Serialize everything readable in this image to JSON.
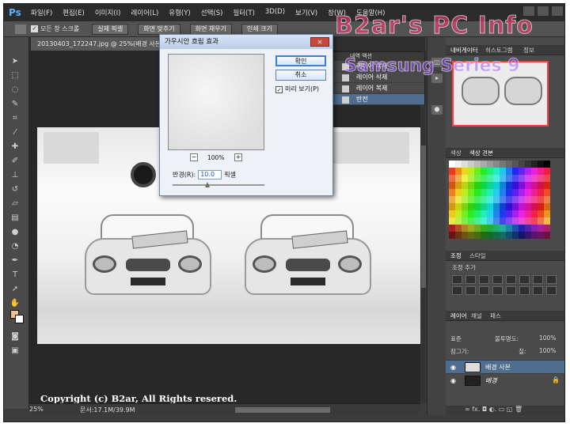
{
  "app": {
    "logo": "Ps"
  },
  "menu": [
    "파일(F)",
    "편집(E)",
    "이미지(I)",
    "레이어(L)",
    "유형(Y)",
    "선택(S)",
    "필터(T)",
    "3D(D)",
    "보기(V)",
    "창(W)",
    "도움말(H)"
  ],
  "options_bar": {
    "checkbox_label": "모든 창 스크롤",
    "buttons": [
      "실제 픽셀",
      "화면 맞추기",
      "화면 채우기",
      "인쇄 크기"
    ]
  },
  "document": {
    "tab_title": "20130403_172247.jpg @ 25%(배경 사본, RGB/8)",
    "copyright": "Copyright (c) B2ar, All Rights resered.",
    "zoom": "25%",
    "doc_size": "문서:17.1M/39.9M"
  },
  "dialog": {
    "title": "가우시안 흐림 효과",
    "ok": "확인",
    "cancel": "취소",
    "preview_label": "미리 보기(P)",
    "preview_checked": "✓",
    "zoom_out": "−",
    "zoom_in": "+",
    "zoom_pct": "100%",
    "radius_label": "반경(R):",
    "radius_value": "10.0",
    "radius_unit": "픽셀",
    "slider_level": 0.38
  },
  "history": {
    "header": "내역    액션",
    "items": [
      "레이어 복제",
      "레이어 삭제",
      "레이어 복제",
      "반전"
    ],
    "selected": 3
  },
  "panels": {
    "navigator_tabs": [
      "내비게이터",
      "히스토그램",
      "정보"
    ],
    "color_tabs": [
      "색상",
      "색상 견본"
    ],
    "adjust_tabs": [
      "조정",
      "스타일"
    ],
    "adjust_label": "조정 추가",
    "layers_tabs": [
      "레이어",
      "채널",
      "패스"
    ],
    "blend_mode": "표준",
    "opacity_label": "불투명도:",
    "opacity_value": "100%",
    "lock_label": "잠그기:",
    "fill_label": "칠:",
    "fill_value": "100%",
    "layers": [
      {
        "name": "배경 사본",
        "selected": true
      },
      {
        "name": "배경",
        "selected": false
      }
    ],
    "bottom_icons": "∞  fx.  ◘  ◐.  ▭  ◱  🗑"
  },
  "watermark": {
    "line1": "B2ar's PC Info",
    "line2": "Samsung Series 9"
  },
  "colors": {
    "accent": "#4f6d8f",
    "dialog_border": "#6d86ad",
    "highlight_red": "#ff3b3b"
  }
}
